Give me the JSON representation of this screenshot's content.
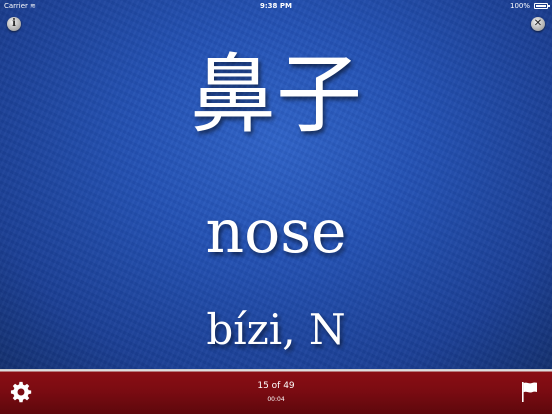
{
  "status": {
    "carrier": "Carrier",
    "time": "9:38 PM",
    "battery": "100%"
  },
  "card": {
    "hanzi": "鼻子",
    "english": "nose",
    "pinyin": "bízi, N"
  },
  "footer": {
    "counter": "15 of 49",
    "timer": "00:04"
  },
  "buttons": {
    "info": "i",
    "close": "✕"
  },
  "colors": {
    "card_blue": "#2452b5",
    "bar_red": "#7a0b12",
    "text": "#ffffff"
  }
}
